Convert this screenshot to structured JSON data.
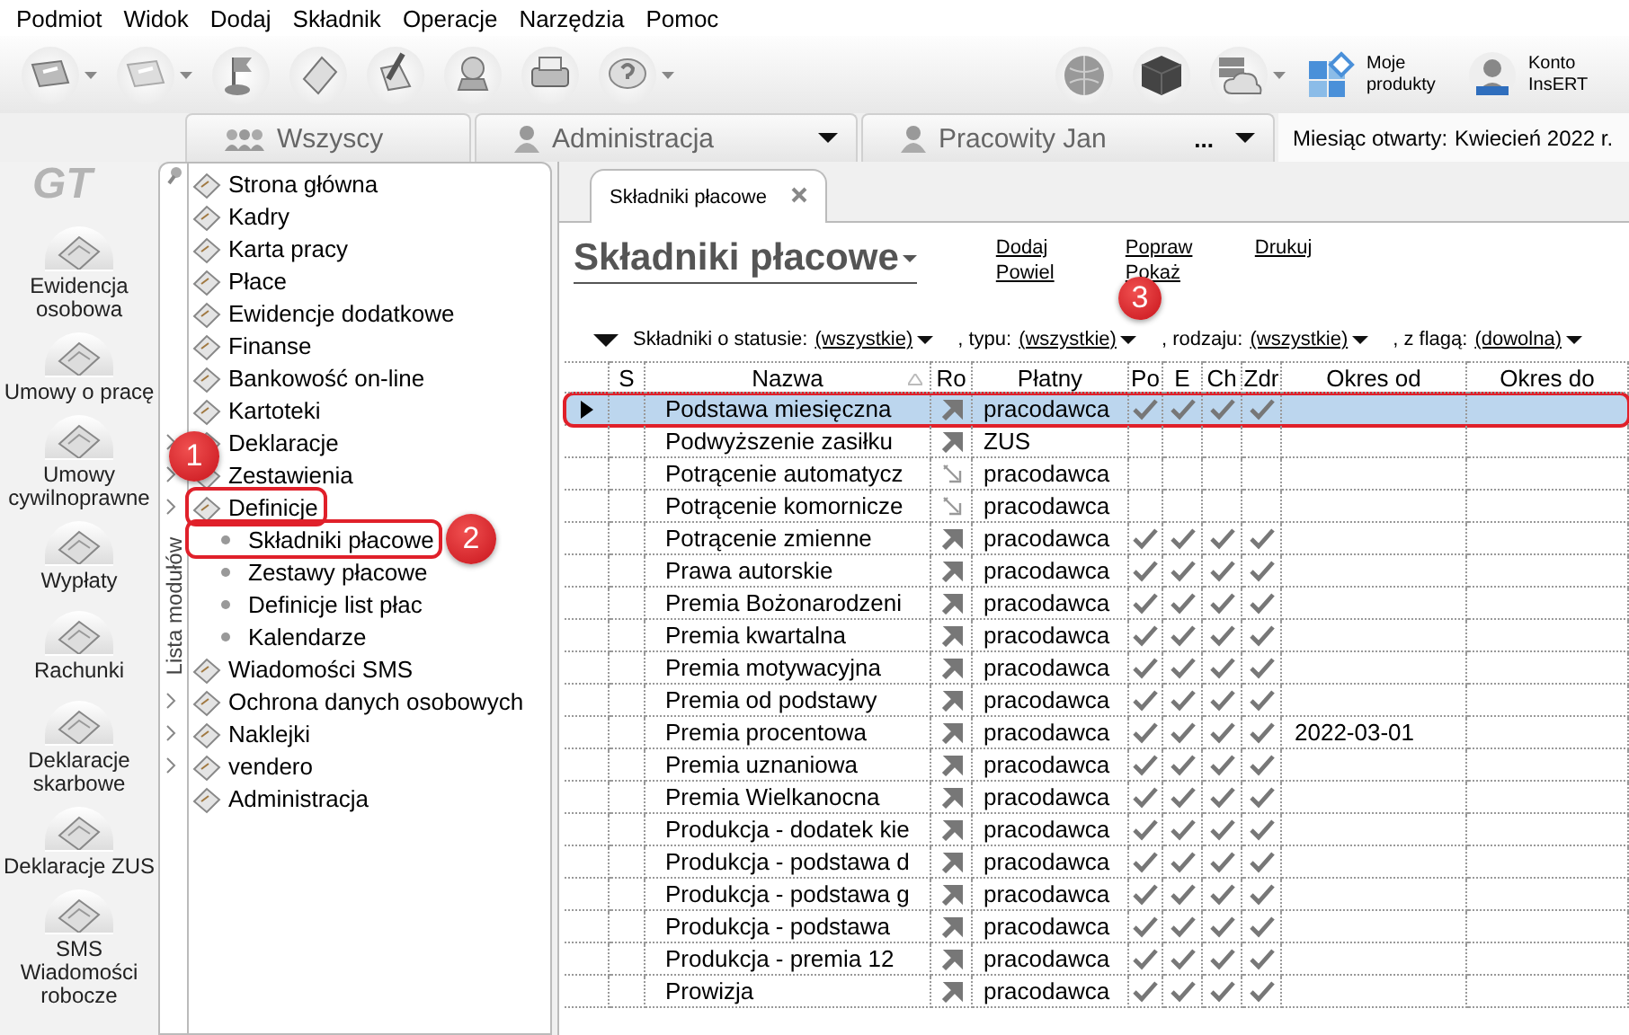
{
  "menu": [
    "Podmiot",
    "Widok",
    "Dodaj",
    "Składnik",
    "Operacje",
    "Narzędzia",
    "Pomoc"
  ],
  "toolbar": {
    "buttons": [
      {
        "menu": true
      },
      {
        "menu": true
      },
      {
        "menu": false
      },
      {
        "menu": false
      },
      {
        "menu": false
      },
      {
        "menu": false
      },
      {
        "menu": false
      },
      {
        "menu": true
      }
    ],
    "right": [
      {
        "menu": false
      },
      {
        "menu": false
      },
      {
        "menu": true
      }
    ],
    "links": [
      "Moje produkty",
      "Konto InsERT"
    ]
  },
  "logo": "GT",
  "tabs": [
    {
      "label": "Wszyscy",
      "dropdown": false
    },
    {
      "label": "Administracja",
      "dropdown": true
    },
    {
      "label": "Pracowity Jan",
      "extra": "...",
      "dropdown": true
    }
  ],
  "period": {
    "label": "Miesiąc otwarty:",
    "value": "Kwiecień 2022 r."
  },
  "modules": [
    "Ewidencja osobowa",
    "Umowy o pracę",
    "Umowy cywilnoprawne",
    "Wypłaty",
    "Rachunki",
    "Deklaracje skarbowe",
    "Deklaracje ZUS",
    "SMS Wiadomości robocze"
  ],
  "tree": {
    "title": "Lista modułów",
    "items": [
      {
        "label": "Strona główna",
        "expandable": false,
        "annotated": false
      },
      {
        "label": "Kadry",
        "expandable": false,
        "annotated": false
      },
      {
        "label": "Karta pracy",
        "expandable": false,
        "annotated": false
      },
      {
        "label": "Płace",
        "expandable": false,
        "annotated": false
      },
      {
        "label": "Ewidencje dodatkowe",
        "expandable": false,
        "annotated": false
      },
      {
        "label": "Finanse",
        "expandable": false,
        "annotated": false
      },
      {
        "label": "Bankowość on-line",
        "expandable": false,
        "annotated": false
      },
      {
        "label": "Kartoteki",
        "expandable": false,
        "annotated": false
      },
      {
        "label": "Deklaracje",
        "expandable": true,
        "annotated": false
      },
      {
        "label": "Zestawienia",
        "expandable": true,
        "annotated": false
      },
      {
        "label": "Definicje",
        "expandable": true,
        "annotated": true,
        "children": [
          {
            "label": "Składniki płacowe",
            "annotated": true
          },
          {
            "label": "Zestawy płacowe",
            "annotated": false
          },
          {
            "label": "Definicje list płac",
            "annotated": false
          },
          {
            "label": "Kalendarze",
            "annotated": false
          }
        ]
      },
      {
        "label": "Wiadomości SMS",
        "expandable": false,
        "annotated": false
      },
      {
        "label": "Ochrona danych osobowych",
        "expandable": true,
        "annotated": false
      },
      {
        "label": "Naklejki",
        "expandable": true,
        "annotated": false
      },
      {
        "label": "vendero",
        "expandable": true,
        "annotated": false
      },
      {
        "label": "Administracja",
        "expandable": false,
        "annotated": false
      }
    ]
  },
  "document": {
    "tab": "Składniki płacowe",
    "title": "Składniki płacowe",
    "actions": [
      [
        "Dodaj",
        "Powiel"
      ],
      [
        "Popraw",
        "Pokaż"
      ],
      [
        "Drukuj"
      ]
    ],
    "filters": [
      {
        "prefix": "Składniki o statusie:",
        "value": "(wszystkie)"
      },
      {
        "prefix": ", typu:",
        "value": "(wszystkie)"
      },
      {
        "prefix": ", rodzaju:",
        "value": "(wszystkie)"
      },
      {
        "prefix": ", z flagą:",
        "value": "(dowolna)"
      }
    ]
  },
  "table": {
    "columns": [
      {
        "label": "S",
        "sorted": false
      },
      {
        "label": "Nazwa",
        "sorted": true
      },
      {
        "label": "Ro",
        "sorted": false
      },
      {
        "label": "Płatny",
        "sorted": false
      },
      {
        "label": "Po",
        "sorted": false
      },
      {
        "label": "E",
        "sorted": false
      },
      {
        "label": "Ch",
        "sorted": false
      },
      {
        "label": "Zdr",
        "sorted": false
      },
      {
        "label": "Okres od",
        "sorted": false
      },
      {
        "label": "Okres do",
        "sorted": false
      }
    ],
    "rows": [
      {
        "name": "Podstawa miesięczna",
        "kind": "addition",
        "payer": "pracodawca",
        "po": true,
        "e": true,
        "ch": true,
        "zdr": true,
        "selected": true,
        "annotated": true
      },
      {
        "name": "Podwyższenie zasiłku",
        "kind": "addition",
        "payer": "ZUS",
        "po": false,
        "e": false,
        "ch": false,
        "zdr": false,
        "selected": false,
        "annotated": false
      },
      {
        "name": "Potrącenie automatycz",
        "kind": "deduction",
        "payer": "pracodawca",
        "po": false,
        "e": false,
        "ch": false,
        "zdr": false,
        "selected": false,
        "annotated": false
      },
      {
        "name": "Potrącenie komornicze",
        "kind": "deduction",
        "payer": "pracodawca",
        "po": false,
        "e": false,
        "ch": false,
        "zdr": false,
        "selected": false,
        "annotated": false
      },
      {
        "name": "Potrącenie zmienne",
        "kind": "addition",
        "payer": "pracodawca",
        "po": true,
        "e": true,
        "ch": true,
        "zdr": true,
        "selected": false,
        "annotated": false
      },
      {
        "name": "Prawa autorskie",
        "kind": "addition",
        "payer": "pracodawca",
        "po": true,
        "e": true,
        "ch": true,
        "zdr": true,
        "selected": false,
        "annotated": false
      },
      {
        "name": "Premia Bożonarodzeni",
        "kind": "addition",
        "payer": "pracodawca",
        "po": true,
        "e": true,
        "ch": true,
        "zdr": true,
        "selected": false,
        "annotated": false
      },
      {
        "name": "Premia kwartalna",
        "kind": "addition",
        "payer": "pracodawca",
        "po": true,
        "e": true,
        "ch": true,
        "zdr": true,
        "selected": false,
        "annotated": false
      },
      {
        "name": "Premia motywacyjna",
        "kind": "addition",
        "payer": "pracodawca",
        "po": true,
        "e": true,
        "ch": true,
        "zdr": true,
        "selected": false,
        "annotated": false
      },
      {
        "name": "Premia od podstawy",
        "kind": "addition",
        "payer": "pracodawca",
        "po": true,
        "e": true,
        "ch": true,
        "zdr": true,
        "selected": false,
        "annotated": false
      },
      {
        "name": "Premia procentowa",
        "kind": "addition",
        "payer": "pracodawca",
        "po": true,
        "e": true,
        "ch": true,
        "zdr": true,
        "okres_od": "2022-03-01",
        "selected": false,
        "annotated": false
      },
      {
        "name": "Premia uznaniowa",
        "kind": "addition",
        "payer": "pracodawca",
        "po": true,
        "e": true,
        "ch": true,
        "zdr": true,
        "selected": false,
        "annotated": false
      },
      {
        "name": "Premia Wielkanocna",
        "kind": "addition",
        "payer": "pracodawca",
        "po": true,
        "e": true,
        "ch": true,
        "zdr": true,
        "selected": false,
        "annotated": false
      },
      {
        "name": "Produkcja - dodatek kie",
        "kind": "addition",
        "payer": "pracodawca",
        "po": true,
        "e": true,
        "ch": true,
        "zdr": true,
        "selected": false,
        "annotated": false
      },
      {
        "name": "Produkcja - podstawa d",
        "kind": "addition",
        "payer": "pracodawca",
        "po": true,
        "e": true,
        "ch": true,
        "zdr": true,
        "selected": false,
        "annotated": false
      },
      {
        "name": "Produkcja - podstawa g",
        "kind": "addition",
        "payer": "pracodawca",
        "po": true,
        "e": true,
        "ch": true,
        "zdr": true,
        "selected": false,
        "annotated": false
      },
      {
        "name": "Produkcja - podstawa",
        "kind": "addition",
        "payer": "pracodawca",
        "po": true,
        "e": true,
        "ch": true,
        "zdr": true,
        "selected": false,
        "annotated": false
      },
      {
        "name": "Produkcja - premia 12",
        "kind": "addition",
        "payer": "pracodawca",
        "po": true,
        "e": true,
        "ch": true,
        "zdr": true,
        "selected": false,
        "annotated": false
      },
      {
        "name": "Prowizja",
        "kind": "addition",
        "payer": "pracodawca",
        "po": true,
        "e": true,
        "ch": true,
        "zdr": true,
        "selected": false,
        "annotated": false
      }
    ]
  },
  "callouts": [
    "1",
    "2",
    "3"
  ]
}
